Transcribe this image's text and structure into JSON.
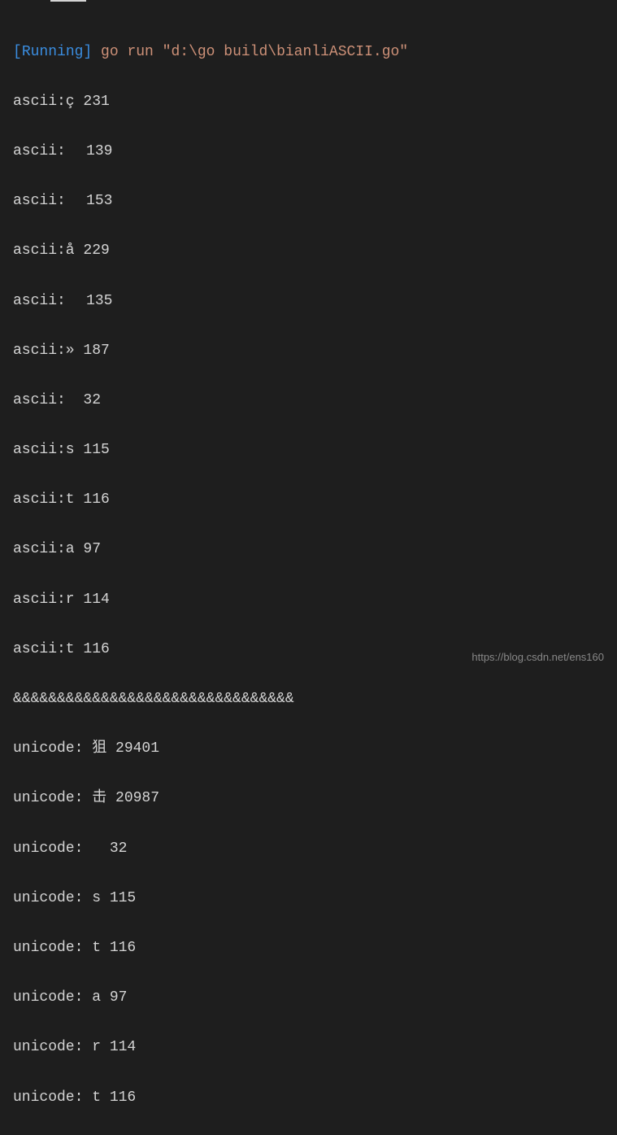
{
  "running_prefix_open": "[",
  "running_text": "Running",
  "running_prefix_close": "] ",
  "command": "go run \"d:\\go build\\bianliASCII.go\"",
  "ascii_lines": [
    "ascii:ç 231",
    "ascii: 139",
    "ascii: 153",
    "ascii:å 229",
    "ascii: 135",
    "ascii:» 187",
    "ascii:  32",
    "ascii:s 115",
    "ascii:t 116",
    "ascii:a 97",
    "ascii:r 114",
    "ascii:t 116"
  ],
  "separator": "&&&&&&&&&&&&&&&&&&&&&&&&&&&&&&&&",
  "unicode_lines": [
    "unicode: 狙 29401",
    "unicode: 击 20987",
    "unicode:   32",
    "unicode: s 115",
    "unicode: t 116",
    "unicode: a 97",
    "unicode: r 114",
    "unicode: t 116"
  ],
  "watermark": "https://blog.csdn.net/ens160"
}
